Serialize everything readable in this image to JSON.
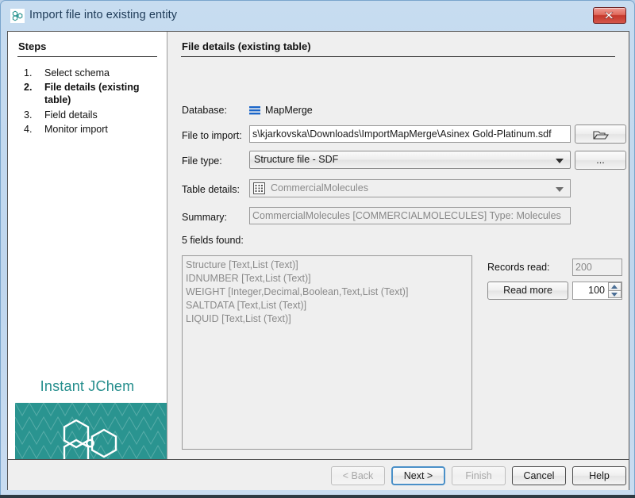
{
  "window": {
    "title": "Import file into existing entity",
    "icon": "jchem-hexagons-icon",
    "close_label": "Close"
  },
  "steps": {
    "heading": "Steps",
    "items": [
      {
        "num": "1.",
        "label": "Select schema",
        "current": false
      },
      {
        "num": "2.",
        "label": "File details (existing table)",
        "current": true
      },
      {
        "num": "3.",
        "label": "Field details",
        "current": false
      },
      {
        "num": "4.",
        "label": "Monitor import",
        "current": false
      }
    ]
  },
  "brand": {
    "name": "Instant JChem",
    "accent": "#258e8d",
    "art_bg": "#2a9490"
  },
  "content": {
    "heading": "File details (existing table)",
    "database": {
      "label": "Database:",
      "value": "MapMerge",
      "icon": "database-lines-icon"
    },
    "file_to_import": {
      "label": "File to import:",
      "value": "s\\kjarkovska\\Downloads\\ImportMapMerge\\Asinex Gold-Platinum.sdf",
      "browse_icon": "folder-open-icon",
      "browse_label": ""
    },
    "file_type": {
      "label": "File type:",
      "value": "Structure file - SDF",
      "options": [
        "Structure file - SDF"
      ],
      "more_label": "..."
    },
    "table_details": {
      "label": "Table details:",
      "value": "CommercialMolecules",
      "icon": "table-grid-icon"
    },
    "summary": {
      "label": "Summary:",
      "value": "CommercialMolecules [COMMERCIALMOLECULES] Type: Molecules"
    },
    "fields": {
      "label": "5 fields found:",
      "items": [
        "Structure [Text,List (Text)]",
        "IDNUMBER [Text,List (Text)]",
        "WEIGHT [Integer,Decimal,Boolean,Text,List (Text)]",
        "SALTDATA [Text,List (Text)]",
        "LIQUID [Text,List (Text)]"
      ]
    },
    "records": {
      "label": "Records read:",
      "value": "200",
      "read_more_label": "Read more",
      "spinner_value": "100"
    }
  },
  "footer": {
    "buttons": [
      {
        "name": "back",
        "label": "< Back",
        "state": "disabled"
      },
      {
        "name": "next",
        "label": "Next >",
        "state": "default"
      },
      {
        "name": "finish",
        "label": "Finish",
        "state": "disabled"
      },
      {
        "name": "cancel",
        "label": "Cancel",
        "state": "normal"
      },
      {
        "name": "help",
        "label": "Help",
        "state": "normal"
      }
    ]
  }
}
